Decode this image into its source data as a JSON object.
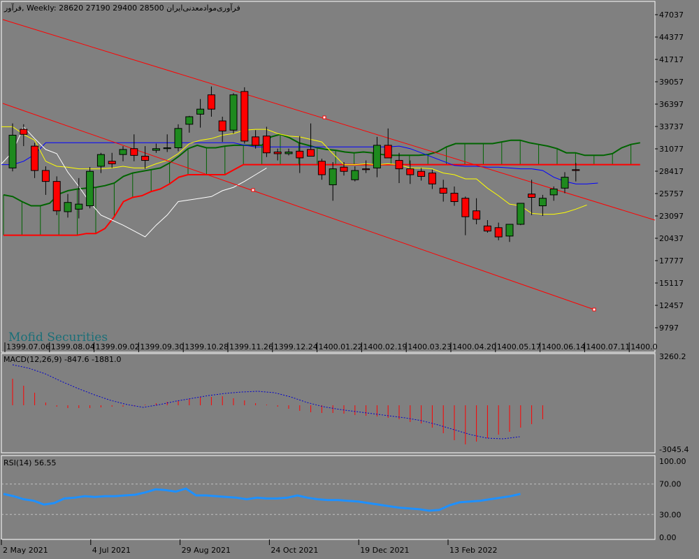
{
  "header": {
    "symbol": "فرآور",
    "timeframe": "Weekly",
    "ohlc": "28620 27190 29400 28500",
    "description": "فرآوری‌موادمعدنی‌ایران"
  },
  "watermark": "Mofid Securities",
  "colors": {
    "background": "#808080",
    "bull": "#1e8a1e",
    "bear": "#ff0000",
    "channel": "#ff0000",
    "tenkan": "#0000ff",
    "kijun": "#ffff00",
    "chikou": "#ffffff",
    "kumo_bull": "#006400",
    "kumo_bear": "#ff0000",
    "macd_hist": "#ff0000",
    "macd_signal": "#0000cc",
    "rsi": "#1e90ff"
  },
  "main_axis": {
    "ticks": [
      "47037",
      "44377",
      "41717",
      "39057",
      "36397",
      "33737",
      "31077",
      "28417",
      "25757",
      "23097",
      "20437",
      "17777",
      "15117",
      "12457",
      "9797"
    ]
  },
  "main_time_labels": [
    "1399.07.06",
    "1399.08.04",
    "1399.09.02",
    "1399.09.30",
    "1399.10.28",
    "1399.11.26",
    "1399.12.24",
    "1400.01.22",
    "1400.02.19",
    "1400.03.23",
    "1400.04.20",
    "1400.05.17",
    "1400.06.14",
    "1400.07.11",
    "1400.0"
  ],
  "macd": {
    "label": "MACD(12,26,9) -847.6 -1881.0",
    "max_label": "3260.2",
    "min_label": "-3045.4"
  },
  "rsi": {
    "label": "RSI(14) 56.55",
    "levels": [
      "100.00",
      "70.00",
      "30.00",
      "0.00"
    ]
  },
  "bottom_time_labels": [
    "2 May 2021",
    "4 Jul 2021",
    "29 Aug 2021",
    "24 Oct 2021",
    "19 Dec 2021",
    "13 Feb 2022"
  ],
  "chart_data": {
    "type": "candlestick",
    "price_range": [
      8500,
      48500
    ],
    "candles": [
      {
        "o": 28800,
        "h": 34100,
        "l": 28400,
        "c": 32700
      },
      {
        "o": 33400,
        "h": 34000,
        "l": 31400,
        "c": 32800
      },
      {
        "o": 31400,
        "h": 31800,
        "l": 27600,
        "c": 28500
      },
      {
        "o": 28500,
        "h": 29000,
        "l": 25600,
        "c": 27200
      },
      {
        "o": 27200,
        "h": 27800,
        "l": 23200,
        "c": 23700
      },
      {
        "o": 23600,
        "h": 25700,
        "l": 22900,
        "c": 24700
      },
      {
        "o": 23900,
        "h": 27600,
        "l": 22800,
        "c": 24500
      },
      {
        "o": 24300,
        "h": 28900,
        "l": 24000,
        "c": 28400
      },
      {
        "o": 29000,
        "h": 30600,
        "l": 28200,
        "c": 30400
      },
      {
        "o": 29600,
        "h": 30600,
        "l": 28800,
        "c": 29300
      },
      {
        "o": 30400,
        "h": 31400,
        "l": 29600,
        "c": 31000
      },
      {
        "o": 31100,
        "h": 32800,
        "l": 29600,
        "c": 30300
      },
      {
        "o": 30200,
        "h": 31400,
        "l": 28700,
        "c": 29700
      },
      {
        "o": 30900,
        "h": 31700,
        "l": 30600,
        "c": 31100
      },
      {
        "o": 31100,
        "h": 32800,
        "l": 30700,
        "c": 31200
      },
      {
        "o": 31200,
        "h": 34000,
        "l": 30800,
        "c": 33500
      },
      {
        "o": 34000,
        "h": 35000,
        "l": 33000,
        "c": 34900
      },
      {
        "o": 35200,
        "h": 37000,
        "l": 33600,
        "c": 35800
      },
      {
        "o": 37500,
        "h": 38500,
        "l": 34900,
        "c": 35800
      },
      {
        "o": 34400,
        "h": 34900,
        "l": 31900,
        "c": 33200
      },
      {
        "o": 33300,
        "h": 37700,
        "l": 32900,
        "c": 37500
      },
      {
        "o": 37900,
        "h": 38400,
        "l": 31700,
        "c": 32000
      },
      {
        "o": 32500,
        "h": 33300,
        "l": 31100,
        "c": 31500
      },
      {
        "o": 32600,
        "h": 33700,
        "l": 30100,
        "c": 30600
      },
      {
        "o": 30700,
        "h": 31100,
        "l": 29700,
        "c": 30500
      },
      {
        "o": 30500,
        "h": 31100,
        "l": 30300,
        "c": 30700
      },
      {
        "o": 30800,
        "h": 32600,
        "l": 28200,
        "c": 30000
      },
      {
        "o": 31000,
        "h": 34100,
        "l": 30200,
        "c": 30200
      },
      {
        "o": 29600,
        "h": 29900,
        "l": 27400,
        "c": 28000
      },
      {
        "o": 26800,
        "h": 29500,
        "l": 24900,
        "c": 28700
      },
      {
        "o": 28900,
        "h": 29500,
        "l": 27900,
        "c": 28400
      },
      {
        "o": 27400,
        "h": 29000,
        "l": 27200,
        "c": 28500
      },
      {
        "o": 28700,
        "h": 29700,
        "l": 28200,
        "c": 28600
      },
      {
        "o": 28800,
        "h": 32500,
        "l": 27700,
        "c": 31500
      },
      {
        "o": 31500,
        "h": 33500,
        "l": 30700,
        "c": 30000
      },
      {
        "o": 29700,
        "h": 30600,
        "l": 27000,
        "c": 28700
      },
      {
        "o": 28700,
        "h": 29700,
        "l": 26900,
        "c": 28000
      },
      {
        "o": 28400,
        "h": 28800,
        "l": 27300,
        "c": 27800
      },
      {
        "o": 28200,
        "h": 28600,
        "l": 26300,
        "c": 26900
      },
      {
        "o": 26400,
        "h": 27400,
        "l": 24800,
        "c": 25800
      },
      {
        "o": 25800,
        "h": 26600,
        "l": 24300,
        "c": 24800
      },
      {
        "o": 25200,
        "h": 25400,
        "l": 20800,
        "c": 23000
      },
      {
        "o": 23700,
        "h": 25200,
        "l": 22100,
        "c": 22700
      },
      {
        "o": 21900,
        "h": 22600,
        "l": 21100,
        "c": 21300
      },
      {
        "o": 21700,
        "h": 22300,
        "l": 20200,
        "c": 20600
      },
      {
        "o": 20700,
        "h": 22000,
        "l": 20000,
        "c": 22100
      },
      {
        "o": 22100,
        "h": 24600,
        "l": 22000,
        "c": 24600
      },
      {
        "o": 25700,
        "h": 27400,
        "l": 23200,
        "c": 25300
      },
      {
        "o": 24300,
        "h": 25600,
        "l": 23100,
        "c": 25200
      },
      {
        "o": 25600,
        "h": 26600,
        "l": 24900,
        "c": 26300
      },
      {
        "o": 26400,
        "h": 28300,
        "l": 25800,
        "c": 27700
      },
      {
        "o": 28600,
        "h": 29400,
        "l": 27200,
        "c": 28500
      }
    ],
    "tenkan": [
      29200,
      29200,
      29600,
      30400,
      31800,
      31800,
      31800,
      31800,
      31800,
      31800,
      31800,
      31800,
      31800,
      31800,
      31800,
      31800,
      31800,
      31800,
      31800,
      31800,
      31800,
      31800,
      31500,
      31300,
      31300,
      31300,
      31300,
      31300,
      31300,
      31300,
      31300,
      31300,
      31300,
      31300,
      31300,
      31300,
      31400,
      31100,
      30600,
      30100,
      29600,
      29100,
      29000,
      29000,
      28900,
      28900,
      28800,
      28700,
      28700,
      28500,
      27700,
      27200,
      26900,
      26900,
      27000
    ],
    "kijun": [
      33700,
      33700,
      32800,
      32100,
      29600,
      29000,
      28900,
      28700,
      28700,
      28700,
      28800,
      29000,
      28800,
      28800,
      29300,
      29700,
      30500,
      31700,
      32100,
      32300,
      32700,
      32900,
      33300,
      33400,
      33400,
      32900,
      32600,
      32500,
      32200,
      31900,
      30500,
      29200,
      29200,
      29300,
      29200,
      29300,
      29200,
      28800,
      28800,
      28700,
      28200,
      28000,
      27500,
      27500,
      26400,
      25500,
      24500,
      24300,
      23400,
      23300,
      23300,
      23500,
      23900,
      24400
    ],
    "chikou": [
      29300,
      30700,
      33700,
      32300,
      31000,
      30500,
      28300,
      26600,
      24700,
      23200,
      22600,
      22000,
      21300,
      20600,
      22000,
      23200,
      24800,
      25000,
      25200,
      25400,
      26100,
      26500,
      27200,
      28000,
      28800
    ]
  }
}
